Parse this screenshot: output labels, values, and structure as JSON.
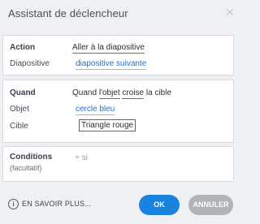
{
  "dialog": {
    "title": "Assistant de déclencheur",
    "close_icon": "close-icon"
  },
  "action": {
    "label": "Action",
    "value": "Aller à la diapositive",
    "slide_label": "Diapositive",
    "slide_value": "diapositive suivante"
  },
  "quand": {
    "label": "Quand",
    "sentence_prefix": "Quand ",
    "sentence_object": "l'objet",
    "sentence_space": " ",
    "sentence_event": "croise",
    "sentence_suffix": " la cible",
    "object_label": "Objet",
    "object_value": "cercle bleu",
    "target_label": "Cible",
    "target_value": "Triangle rouge"
  },
  "conditions": {
    "label": "Conditions",
    "sublabel": "(facultatif)",
    "add_placeholder": "+ si"
  },
  "footer": {
    "info_icon_glyph": "i",
    "info_text": "EN SAVOIR PLUS...",
    "ok_label": "OK",
    "cancel_label": "ANNULER"
  },
  "colors": {
    "accent": "#1a83e0",
    "link": "#2a6ec5",
    "cancel": "#b0b3b7"
  }
}
